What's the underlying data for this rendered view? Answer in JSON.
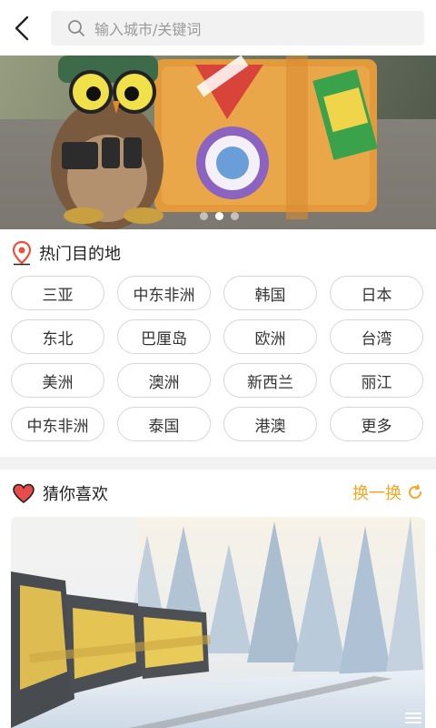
{
  "header": {
    "search_placeholder": "输入城市/关键词"
  },
  "banner": {
    "slide_count": 3,
    "active_index": 1
  },
  "hot_destinations": {
    "title": "热门目的地",
    "items": [
      "三亚",
      "中东非洲",
      "韩国",
      "日本",
      "东北",
      "巴厘岛",
      "欧洲",
      "台湾",
      "美洲",
      "澳洲",
      "新西兰",
      "丽江",
      "中东非洲",
      "泰国",
      "港澳",
      "更多"
    ]
  },
  "guess_you_like": {
    "title": "猜你喜欢",
    "refresh_label": "换一换"
  },
  "colors": {
    "accent_orange": "#f5a623",
    "heart_red": "#e94b4b",
    "pin_red": "#e8533e"
  }
}
